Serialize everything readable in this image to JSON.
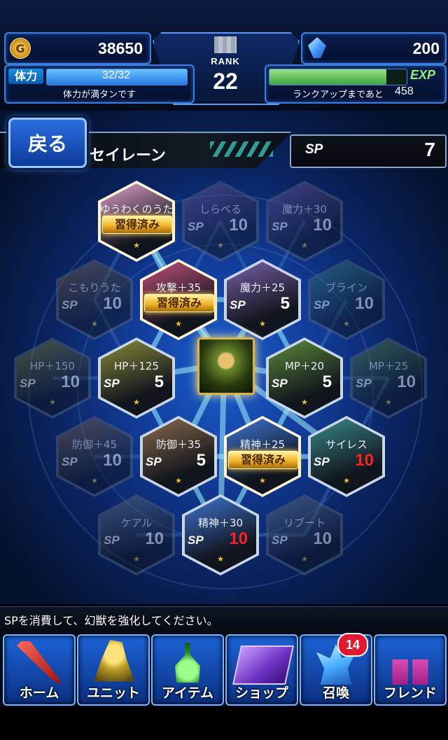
{
  "header": {
    "gil": "38650",
    "gems": "200",
    "rank_label": "RANK",
    "rank": "22",
    "stamina_label": "体力",
    "stamina": "32/32",
    "stamina_msg": "体力が満タンです",
    "exp_label": "EXP",
    "exp_msg": "ランクアップまであと",
    "exp_remaining": "458",
    "stamina_fill": 1.0,
    "exp_fill": 0.85
  },
  "nav_top": {
    "back": "戻る",
    "esper_name": "セイレーン",
    "sp_label": "SP",
    "sp_value": "7"
  },
  "board": {
    "acquired_label": "習得済み",
    "sp_label": "SP",
    "nodes": [
      {
        "id": "n0",
        "label": "ゆうわくのうた",
        "cost": "",
        "acquired": true,
        "color": "pink",
        "unlocked": true
      },
      {
        "id": "n1",
        "label": "しらべる",
        "cost": "10",
        "acquired": false,
        "color": "purple",
        "unlocked": false
      },
      {
        "id": "n2",
        "label": "魔力＋30",
        "cost": "10",
        "acquired": false,
        "color": "purple",
        "unlocked": false
      },
      {
        "id": "n3",
        "label": "こもりうた",
        "cost": "10",
        "acquired": false,
        "color": "brown",
        "unlocked": false
      },
      {
        "id": "n4",
        "label": "攻撃＋35",
        "cost": "",
        "acquired": true,
        "color": "red",
        "unlocked": true
      },
      {
        "id": "n5",
        "label": "魔力＋25",
        "cost": "5",
        "acquired": false,
        "color": "purple",
        "unlocked": true
      },
      {
        "id": "n6",
        "label": "ブライン",
        "cost": "10",
        "acquired": false,
        "color": "teal",
        "unlocked": false
      },
      {
        "id": "n7",
        "label": "HP＋150",
        "cost": "10",
        "acquired": false,
        "color": "olive",
        "unlocked": false
      },
      {
        "id": "n8",
        "label": "HP＋125",
        "cost": "5",
        "acquired": false,
        "color": "olive",
        "unlocked": true
      },
      {
        "id": "n9",
        "label": "MP＋20",
        "cost": "5",
        "acquired": false,
        "color": "green",
        "unlocked": true
      },
      {
        "id": "n10",
        "label": "MP＋25",
        "cost": "10",
        "acquired": false,
        "color": "green",
        "unlocked": false
      },
      {
        "id": "n11",
        "label": "防御＋45",
        "cost": "10",
        "acquired": false,
        "color": "brown",
        "unlocked": false
      },
      {
        "id": "n12",
        "label": "防御＋35",
        "cost": "5",
        "acquired": false,
        "color": "brown",
        "unlocked": true
      },
      {
        "id": "n13",
        "label": "精神＋25",
        "cost": "",
        "acquired": true,
        "color": "blue",
        "unlocked": true
      },
      {
        "id": "n14",
        "label": "サイレス",
        "cost": "10",
        "acquired": false,
        "color": "teal",
        "unlocked": true,
        "red": true
      },
      {
        "id": "n15",
        "label": "ケアル",
        "cost": "10",
        "acquired": false,
        "color": "gray",
        "unlocked": false
      },
      {
        "id": "n16",
        "label": "精神＋30",
        "cost": "10",
        "acquired": false,
        "color": "blue",
        "unlocked": true,
        "red": true
      },
      {
        "id": "n17",
        "label": "リブート",
        "cost": "10",
        "acquired": false,
        "color": "gray",
        "unlocked": false
      }
    ]
  },
  "footer": {
    "message": "SPを消費して、幻獣を強化してください。",
    "nav": [
      {
        "label": "ホーム"
      },
      {
        "label": "ユニット"
      },
      {
        "label": "アイテム"
      },
      {
        "label": "ショップ"
      },
      {
        "label": "召喚"
      },
      {
        "label": "フレンド"
      }
    ],
    "summon_badge": "14"
  },
  "colors": {
    "pink": "#e0a0c8",
    "red": "#c05078",
    "purple": "#7a5fa8",
    "brown": "#8a6a4a",
    "teal": "#3a8a8a",
    "olive": "#8a8a3a",
    "green": "#5a8a3a",
    "blue": "#3f74d0",
    "gray": "#6a7a8a"
  }
}
